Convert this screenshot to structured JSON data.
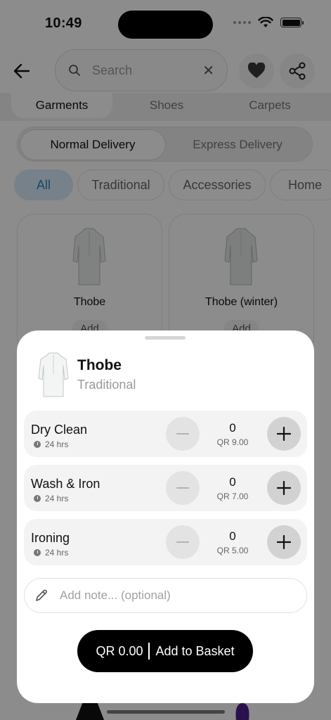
{
  "status_bar": {
    "time": "10:49"
  },
  "header": {
    "search_placeholder": "Search",
    "icons": {
      "back": "arrow-left-icon",
      "search": "search-icon",
      "clear": "close-icon",
      "favorite": "heart-icon",
      "share": "share-icon"
    }
  },
  "categories": [
    "Garments",
    "Shoes",
    "Carpets"
  ],
  "delivery": {
    "options": [
      "Normal Delivery",
      "Express Delivery"
    ],
    "selected": "Normal Delivery"
  },
  "filters": {
    "items": [
      "All",
      "Traditional",
      "Accessories",
      "Home"
    ],
    "selected": "All"
  },
  "products": [
    {
      "name": "Thobe",
      "action": "Add"
    },
    {
      "name": "Thobe (winter)",
      "action": "Add"
    }
  ],
  "sheet": {
    "title": "Thobe",
    "subtitle": "Traditional",
    "services": [
      {
        "name": "Dry Clean",
        "duration": "24 hrs",
        "qty": "0",
        "price": "QR 9.00"
      },
      {
        "name": "Wash & Iron",
        "duration": "24 hrs",
        "qty": "0",
        "price": "QR 7.00"
      },
      {
        "name": "Ironing",
        "duration": "24 hrs",
        "qty": "0",
        "price": "QR 5.00"
      }
    ],
    "note_placeholder": "Add note... (optional)",
    "cta": {
      "total": "QR 0.00",
      "label": "Add to Basket"
    }
  },
  "colors": {
    "overlay": "#000000",
    "accent_chip_bg": "#d9ecfb",
    "accent_chip_text": "#2f82c4",
    "cta_bg": "#000000"
  }
}
